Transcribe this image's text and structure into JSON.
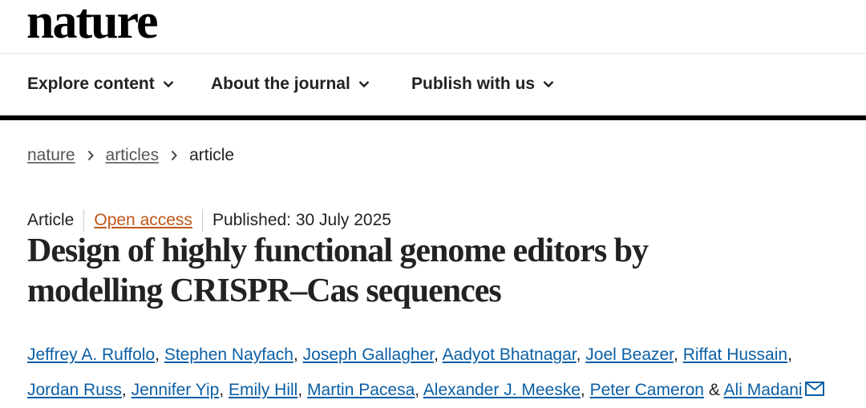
{
  "site": {
    "logo_text": "nature"
  },
  "nav": {
    "items": [
      {
        "label": "Explore content"
      },
      {
        "label": "About the journal"
      },
      {
        "label": "Publish with us"
      }
    ]
  },
  "breadcrumb": {
    "items": [
      {
        "label": "nature"
      },
      {
        "label": "articles"
      }
    ],
    "current": "article"
  },
  "article": {
    "type": "Article",
    "access": "Open access",
    "published": "Published: 30 July 2025",
    "title_line1": "Design of highly functional genome editors by",
    "title_line2": "modelling CRISPR–Cas sequences",
    "authors": [
      "Jeffrey A. Ruffolo",
      "Stephen Nayfach",
      "Joseph Gallagher",
      "Aadyot Bhatnagar",
      "Joel Beazer",
      "Riffat Hussain",
      "Jordan Russ",
      "Jennifer Yip",
      "Emily Hill",
      "Martin Pacesa",
      "Alexander J. Meeske",
      "Peter Cameron",
      "Ali Madani"
    ],
    "comma": ",",
    "ampersand": "&"
  },
  "colors": {
    "link_blue": "#0b5fa5",
    "open_access_orange": "#c0561a",
    "rule_black": "#000000"
  },
  "icons": {
    "nav_chevron": "chevron-down-icon",
    "breadcrumb_separator": "chevron-right-icon",
    "corresponding_author": "mail-icon"
  }
}
